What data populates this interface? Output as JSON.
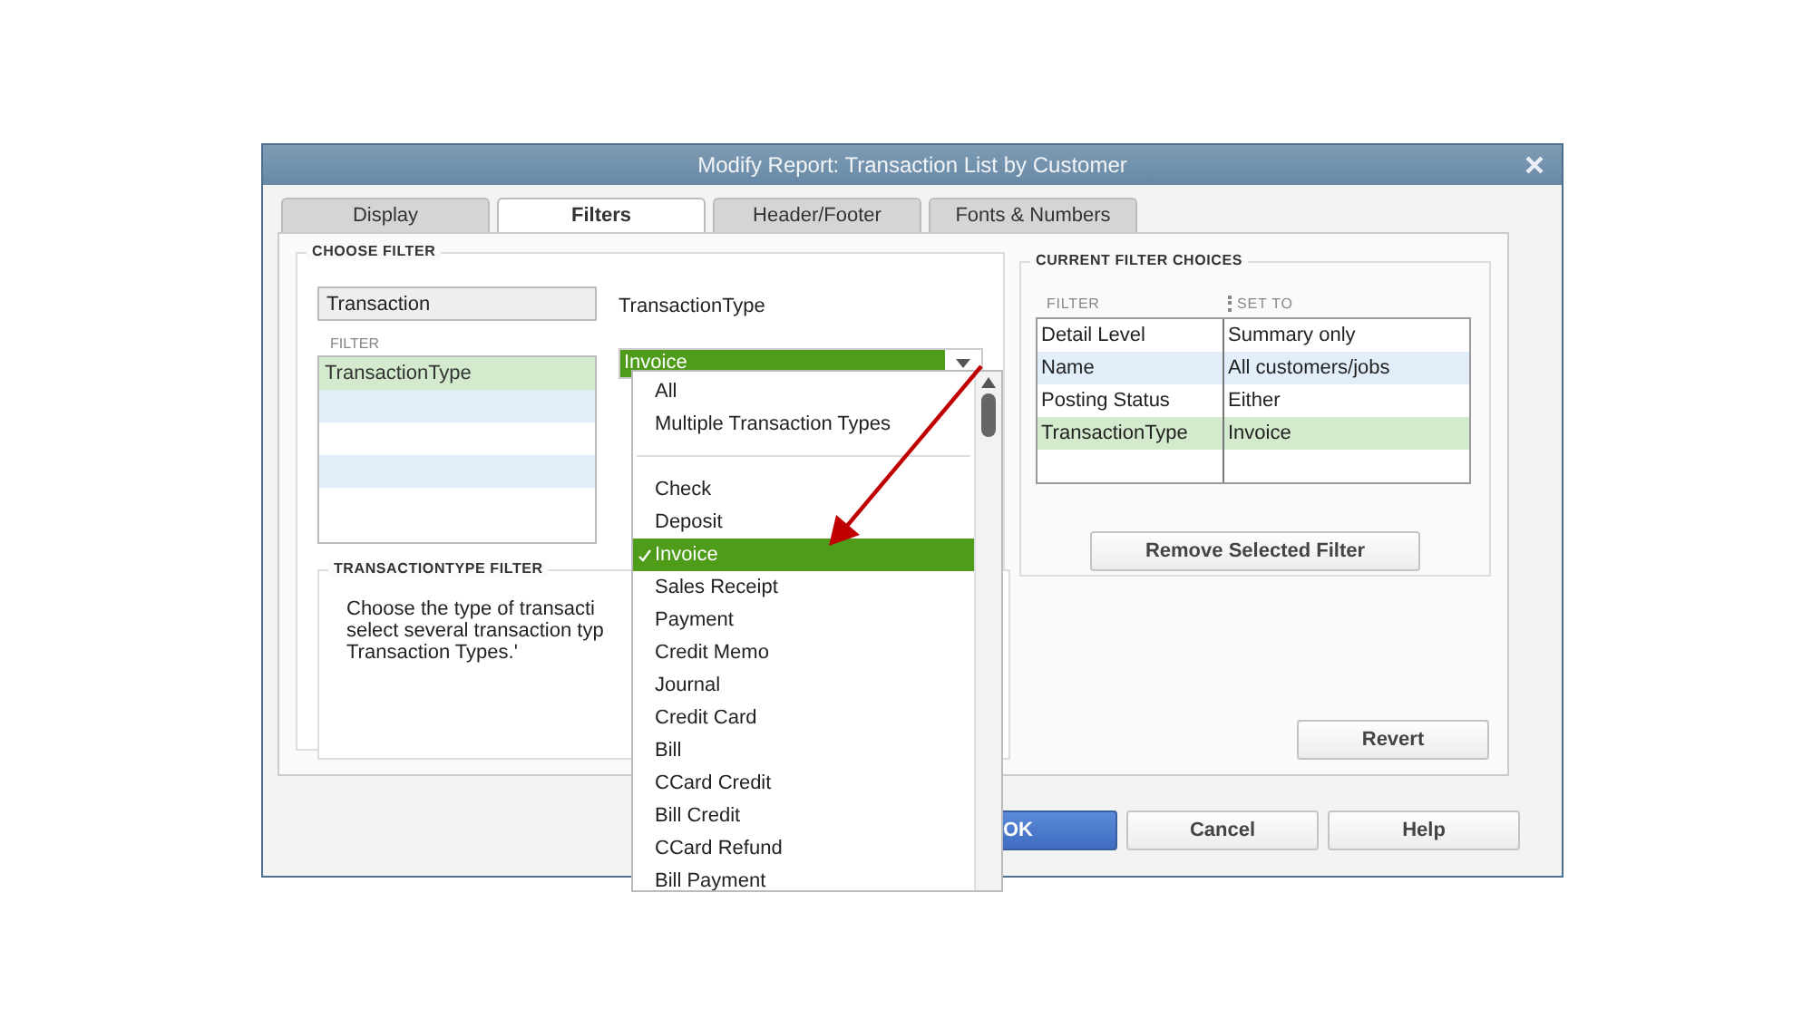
{
  "window": {
    "title": "Modify Report: Transaction List by Customer"
  },
  "tabs": [
    {
      "label": "Display",
      "selected": false
    },
    {
      "label": "Filters",
      "selected": true
    },
    {
      "label": "Header/Footer",
      "selected": false
    },
    {
      "label": "Fonts & Numbers",
      "selected": false
    }
  ],
  "choose_filter": {
    "heading": "CHOOSE FILTER",
    "search_value": "Transaction",
    "list_header": "FILTER",
    "filters": [
      {
        "label": "TransactionType",
        "selected": true
      }
    ]
  },
  "detail": {
    "label": "TransactionType",
    "combo_value": "Invoice"
  },
  "description": {
    "heading": "TRANSACTIONTYPE FILTER",
    "lines": [
      "Choose the type of transacti",
      "select several transaction typ",
      "Transaction Types.'"
    ]
  },
  "dropdown": {
    "items": [
      {
        "kind": "item",
        "label": "All",
        "selected": false
      },
      {
        "kind": "item",
        "label": "Multiple Transaction Types",
        "selected": false
      },
      {
        "kind": "separator"
      },
      {
        "kind": "item",
        "label": "Check",
        "selected": false
      },
      {
        "kind": "item",
        "label": "Deposit",
        "selected": false
      },
      {
        "kind": "item",
        "label": "Invoice",
        "selected": true
      },
      {
        "kind": "item",
        "label": "Sales Receipt",
        "selected": false
      },
      {
        "kind": "item",
        "label": "Payment",
        "selected": false
      },
      {
        "kind": "item",
        "label": "Credit Memo",
        "selected": false
      },
      {
        "kind": "item",
        "label": "Journal",
        "selected": false
      },
      {
        "kind": "item",
        "label": "Credit Card",
        "selected": false
      },
      {
        "kind": "item",
        "label": "Bill",
        "selected": false
      },
      {
        "kind": "item",
        "label": "CCard Credit",
        "selected": false
      },
      {
        "kind": "item",
        "label": "Bill Credit",
        "selected": false
      },
      {
        "kind": "item",
        "label": "CCard Refund",
        "selected": false
      },
      {
        "kind": "item",
        "label": "Bill Payment",
        "selected": false
      }
    ]
  },
  "current_filters": {
    "heading": "CURRENT FILTER CHOICES",
    "columns": [
      "FILTER",
      "SET TO"
    ],
    "rows": [
      {
        "filter": "Detail Level",
        "set_to": "Summary only",
        "selected": false
      },
      {
        "filter": "Name",
        "set_to": "All customers/jobs",
        "selected": false
      },
      {
        "filter": "Posting Status",
        "set_to": "Either",
        "selected": false
      },
      {
        "filter": "TransactionType",
        "set_to": "Invoice",
        "selected": true
      }
    ]
  },
  "remove_button": "Remove Selected Filter",
  "revert_button": "Revert",
  "footer_buttons": [
    {
      "label": "OK",
      "kind": "primary"
    },
    {
      "label": "Cancel",
      "kind": "normal"
    },
    {
      "label": "Help",
      "kind": "normal"
    }
  ]
}
